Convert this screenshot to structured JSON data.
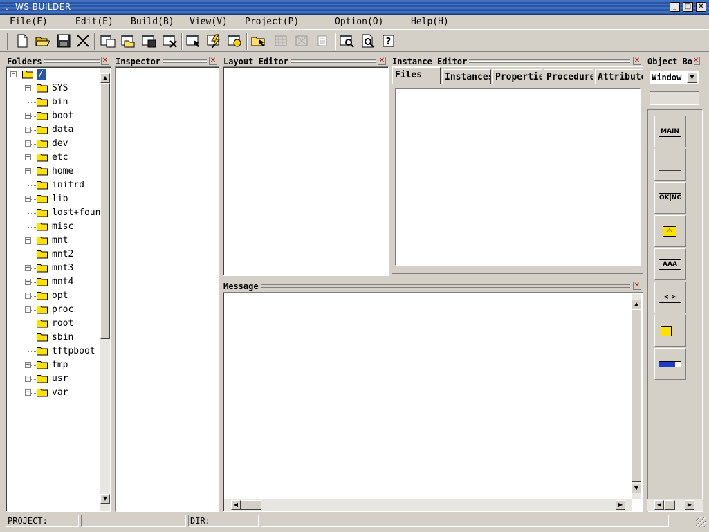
{
  "window": {
    "title": "WS BUILDER"
  },
  "menu": [
    {
      "label": "File(F)"
    },
    {
      "label": "Edit(E)"
    },
    {
      "label": "Build(B)"
    },
    {
      "label": "View(V)"
    },
    {
      "label": "Project(P)"
    },
    {
      "label": "Option(O)"
    },
    {
      "label": "Help(H)"
    }
  ],
  "toolbar": {
    "icons": [
      "new-file-icon",
      "open-folder-icon",
      "save-icon",
      "cut-icon",
      "window-new-icon",
      "window-open-icon",
      "window-save-icon",
      "window-close-icon",
      "select-icon",
      "lightning-icon",
      "settings-window-icon",
      "folder-cursor-icon",
      "grid-disabled-icon",
      "grid-remove-disabled-icon",
      "list-disabled-icon",
      "find-window-icon",
      "find-doc-icon",
      "help-icon"
    ]
  },
  "panels": {
    "folders": "Folders",
    "inspector": "Inspector",
    "layout_editor": "Layout Editor",
    "instance_editor": "Instance Editor",
    "object_box": "Object Bo",
    "message": "Message"
  },
  "instance_tabs": [
    {
      "label": "Files",
      "active": true
    },
    {
      "label": "Instances",
      "active": false
    },
    {
      "label": "Propertie:",
      "active": false
    },
    {
      "label": "Procedure:",
      "active": false
    },
    {
      "label": "Attribute:",
      "active": false
    }
  ],
  "object_box": {
    "selected": "Window",
    "items": [
      {
        "name": "main-window-tool-icon",
        "label": "MAIN"
      },
      {
        "name": "button-tool-icon",
        "label": ""
      },
      {
        "name": "ok-no-tool-icon",
        "label": "OK|NO"
      },
      {
        "name": "warning-tool-icon",
        "label": "⚠"
      },
      {
        "name": "text-field-tool-icon",
        "label": "AAA"
      },
      {
        "name": "spin-tool-icon",
        "label": "<|>"
      },
      {
        "name": "folder-select-tool-icon",
        "label": ""
      },
      {
        "name": "progress-bar-tool-icon",
        "label": ""
      }
    ]
  },
  "tree": {
    "root": "/",
    "items": [
      {
        "name": "SYS",
        "expandable": true
      },
      {
        "name": "bin",
        "expandable": false
      },
      {
        "name": "boot",
        "expandable": true
      },
      {
        "name": "data",
        "expandable": true
      },
      {
        "name": "dev",
        "expandable": true
      },
      {
        "name": "etc",
        "expandable": true
      },
      {
        "name": "home",
        "expandable": true
      },
      {
        "name": "initrd",
        "expandable": false
      },
      {
        "name": "lib",
        "expandable": true
      },
      {
        "name": "lost+found",
        "expandable": false
      },
      {
        "name": "misc",
        "expandable": false
      },
      {
        "name": "mnt",
        "expandable": true
      },
      {
        "name": "mnt2",
        "expandable": false
      },
      {
        "name": "mnt3",
        "expandable": true
      },
      {
        "name": "mnt4",
        "expandable": true
      },
      {
        "name": "opt",
        "expandable": true
      },
      {
        "name": "proc",
        "expandable": true
      },
      {
        "name": "root",
        "expandable": false
      },
      {
        "name": "sbin",
        "expandable": false
      },
      {
        "name": "tftpboot",
        "expandable": false
      },
      {
        "name": "tmp",
        "expandable": true
      },
      {
        "name": "usr",
        "expandable": true
      },
      {
        "name": "var",
        "expandable": true
      }
    ]
  },
  "status": {
    "project_label": "PROJECT:",
    "project_value": "",
    "dir_label": "DIR:",
    "dir_value": ""
  },
  "colors": {
    "titlebar": "#2a55a5",
    "chrome": "#d4d0c8",
    "folder": "#ffe000",
    "close_x": "#c00000"
  }
}
